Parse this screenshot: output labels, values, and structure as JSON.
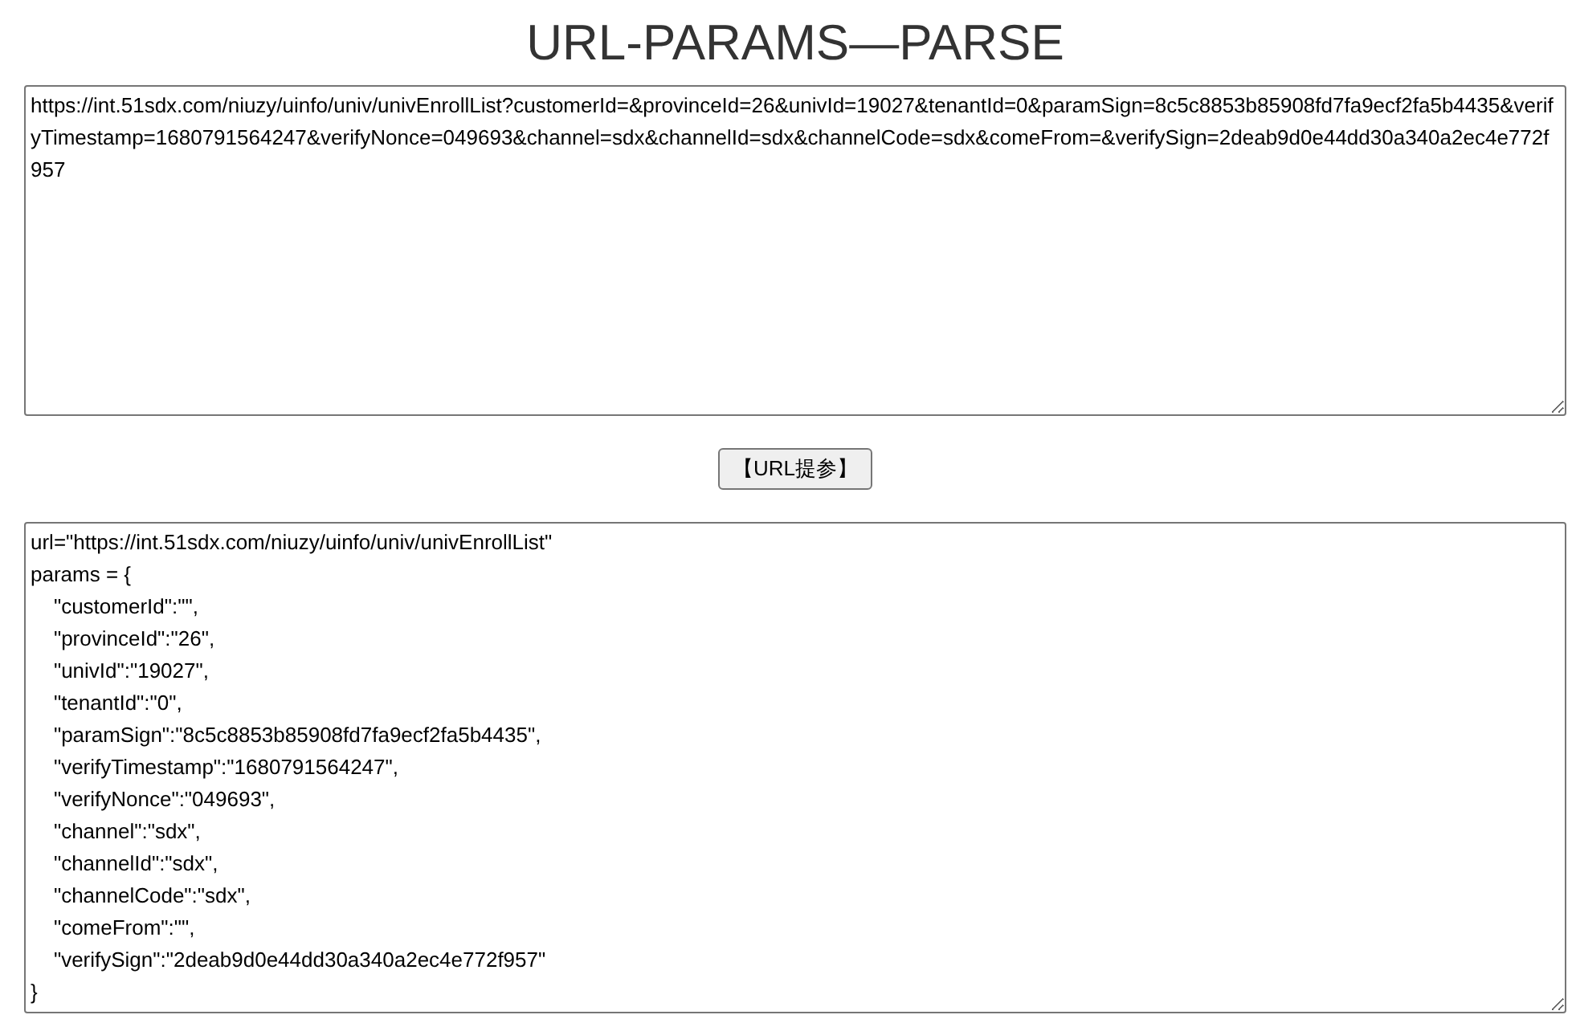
{
  "title": "URL-PARAMS—PARSE",
  "input": {
    "value": "https://int.51sdx.com/niuzy/uinfo/univ/univEnrollList?customerId=&provinceId=26&univId=19027&tenantId=0&paramSign=8c5c8853b85908fd7fa9ecf2fa5b4435&verifyTimestamp=1680791564247&verifyNonce=049693&channel=sdx&channelId=sdx&channelCode=sdx&comeFrom=&verifySign=2deab9d0e44dd30a340a2ec4e772f957"
  },
  "button": {
    "label": "【URL提参】"
  },
  "output": {
    "value": "url=\"https://int.51sdx.com/niuzy/uinfo/univ/univEnrollList\"\nparams = {\n    \"customerId\":\"\",\n    \"provinceId\":\"26\",\n    \"univId\":\"19027\",\n    \"tenantId\":\"0\",\n    \"paramSign\":\"8c5c8853b85908fd7fa9ecf2fa5b4435\",\n    \"verifyTimestamp\":\"1680791564247\",\n    \"verifyNonce\":\"049693\",\n    \"channel\":\"sdx\",\n    \"channelId\":\"sdx\",\n    \"channelCode\":\"sdx\",\n    \"comeFrom\":\"\",\n    \"verifySign\":\"2deab9d0e44dd30a340a2ec4e772f957\"\n}"
  }
}
